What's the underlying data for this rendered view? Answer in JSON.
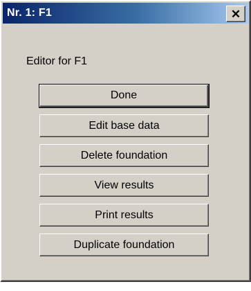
{
  "window": {
    "title": "Nr. 1: F1",
    "close_glyph": "✕"
  },
  "heading": "Editor for F1",
  "buttons": [
    {
      "label": "Done"
    },
    {
      "label": "Edit base data"
    },
    {
      "label": "Delete foundation"
    },
    {
      "label": "View results"
    },
    {
      "label": "Print results"
    },
    {
      "label": "Duplicate foundation"
    }
  ]
}
